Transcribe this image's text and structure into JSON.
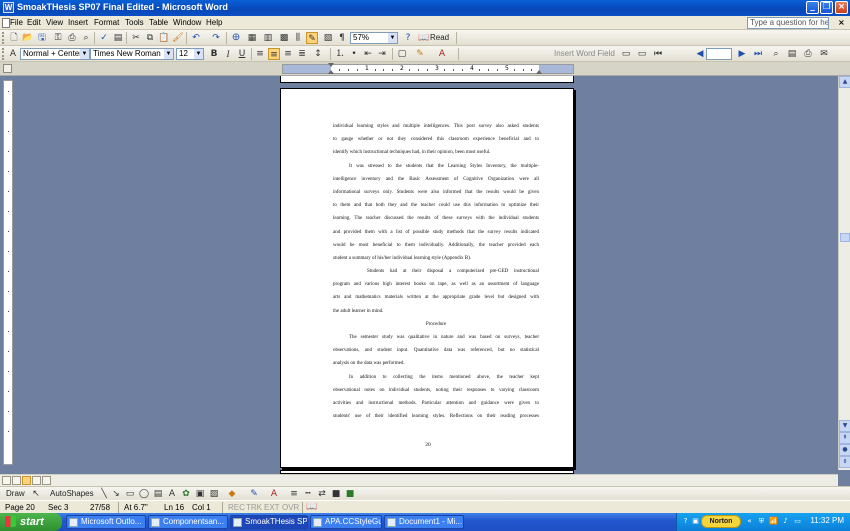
{
  "window": {
    "title": "SmoakTHesis SP07 Final Edited - Microsoft Word",
    "app_icon": "W"
  },
  "menubar": {
    "items": [
      "File",
      "Edit",
      "View",
      "Insert",
      "Format",
      "Tools",
      "Table",
      "Window",
      "Help"
    ],
    "help_placeholder": "Type a question for help"
  },
  "standard_toolbar": {
    "zoom": "57%",
    "read_label": "Read"
  },
  "formatting_toolbar": {
    "style": "Normal + Centered",
    "font": "Times New Roman",
    "size": "12",
    "bold": "B",
    "italic": "I",
    "underline": "U",
    "insert_word_field": "Insert Word Field"
  },
  "ruler": {
    "numbers": [
      "1",
      "2",
      "3",
      "4",
      "5"
    ]
  },
  "document": {
    "lines": [
      "individual learning styles and multiple intelligences.  This post survey also asked students",
      "to gauge whether or not they considered this classroom experience beneficial and to",
      "identify which instructional techniques had, in their opinion, been most useful.",
      "It was stressed to the students that the Learning Styles Inventory, the multiple-",
      "intelligence inventory and the Basic Assessment of Cognitive Organization were all",
      "informational surveys only.  Students were also informed that the results would be given",
      "to them and that both they and the teacher could use this information to optimize their",
      "learning.  The teacher discussed the results of these surveys with the individual students",
      "and provided them with a list of possible study methods that the survey results indicated",
      "would be most beneficial to them individually.  Additionally, the teacher provided each",
      "student a summary of his/her individual learning style (Appendix B).",
      "Students had at their disposal a computerized pre-GED instructional",
      "program and various high interest books on tape, as well as an assortment of language",
      "arts and mathematics materials written at the appropriate grade level but designed with",
      "the adult learner in mind.",
      "Procedure",
      "The semester study was qualitative in nature and was based on surveys, teacher",
      "observations, and student input.  Quantitative data was referenced, but no statistical",
      "analysis on the data was performed.",
      "In addition to collecting the items mentioned above, the teacher kept",
      "observational notes on individual students, noting their responses to varying classroom",
      "activities and instructional methods.  Particular attention and guidance were given to",
      "students' use of their identified learning styles.  Reflections on their reading processes"
    ],
    "page_number": "20"
  },
  "draw_toolbar": {
    "draw_label": "Draw",
    "autoshapes_label": "AutoShapes"
  },
  "statusbar": {
    "page": "Page 20",
    "sec": "Sec 3",
    "pages": "27/58",
    "at": "At 6.7\"",
    "ln": "Ln 16",
    "col": "Col 1",
    "rec": "REC",
    "trk": "TRK",
    "ext": "EXT",
    "ovr": "OVR"
  },
  "taskbar": {
    "start": "start",
    "tasks": [
      "Microsoft Outlo...",
      "Componentsan...",
      "SmoakTHesis SP...",
      "APA.CCStyleGui...",
      "Document1 - Mi..."
    ],
    "norton": "Norton",
    "clock": "11:32 PM"
  },
  "colors": {
    "titlebar": "#0a5fd6",
    "workspace": "#6f7fa0",
    "taskbar": "#2457d0",
    "start": "#2f8f2f"
  }
}
